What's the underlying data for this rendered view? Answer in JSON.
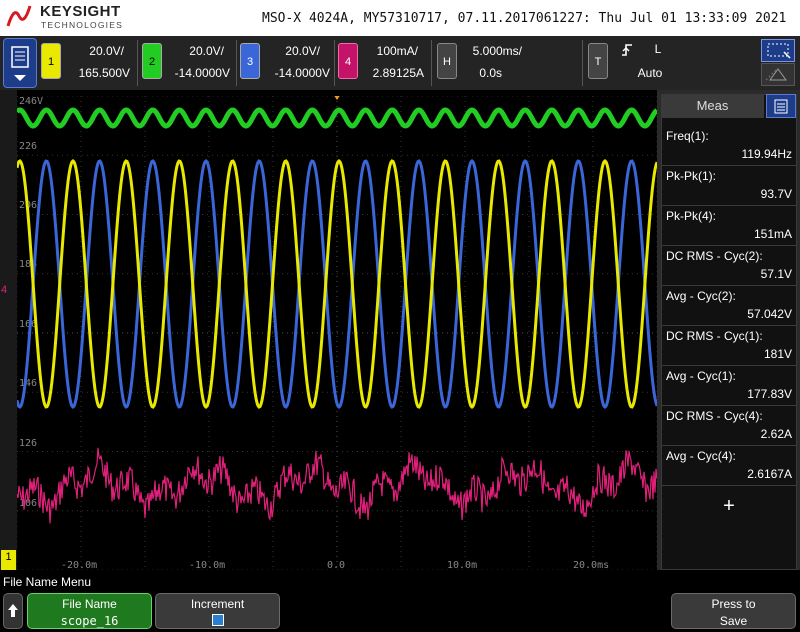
{
  "header": {
    "brand": "KEYSIGHT",
    "brand_sub": "TECHNOLOGIES",
    "scope_info": "MSO-X 4024A, MY57310717, 07.11.2017061227: Thu Jul 01 13:33:09 2021"
  },
  "channels": [
    {
      "num": "1",
      "scale": "20.0V/",
      "offset": "165.500V",
      "color": "#e8e800"
    },
    {
      "num": "2",
      "scale": "20.0V/",
      "offset": "-14.0000V",
      "color": "#22cc22"
    },
    {
      "num": "3",
      "scale": "20.0V/",
      "offset": "-14.0000V",
      "color": "#3a66d8"
    },
    {
      "num": "4",
      "scale": "100mA/",
      "offset": "2.89125A",
      "color": "#e0207a"
    }
  ],
  "horizontal": {
    "label": "H",
    "timebase": "5.000ms/",
    "delay": "0.0s"
  },
  "trigger": {
    "label": "T",
    "slope_icon": "rising-edge-icon",
    "coupling": "L",
    "mode": "Auto"
  },
  "grid": {
    "y_labels": [
      "246V",
      "226",
      "206",
      "186",
      "166",
      "146",
      "126",
      "106"
    ],
    "x_labels": [
      "-20.0m",
      "-10.0m",
      "0.0",
      "10.0m",
      "20.0ms"
    ]
  },
  "measurements": {
    "title": "Meas",
    "items": [
      {
        "label": "Freq(1):",
        "value": "119.94Hz"
      },
      {
        "label": "Pk-Pk(1):",
        "value": "93.7V"
      },
      {
        "label": "Pk-Pk(4):",
        "value": "151mA"
      },
      {
        "label": "DC RMS - Cyc(2):",
        "value": "57.1V"
      },
      {
        "label": "Avg - Cyc(2):",
        "value": "57.042V"
      },
      {
        "label": "DC RMS - Cyc(1):",
        "value": "181V"
      },
      {
        "label": "Avg - Cyc(1):",
        "value": "177.83V"
      },
      {
        "label": "DC RMS - Cyc(4):",
        "value": "2.62A"
      },
      {
        "label": "Avg - Cyc(4):",
        "value": "2.6167A"
      }
    ],
    "add_label": "+"
  },
  "softkeys": {
    "menu_title": "File Name Menu",
    "file_name_label": "File Name",
    "file_name_value": "scope_16",
    "increment_label": "Increment",
    "press_to_save_l1": "Press to",
    "press_to_save_l2": "Save"
  },
  "ground_markers": {
    "ch4": "4",
    "ch1": "1"
  }
}
